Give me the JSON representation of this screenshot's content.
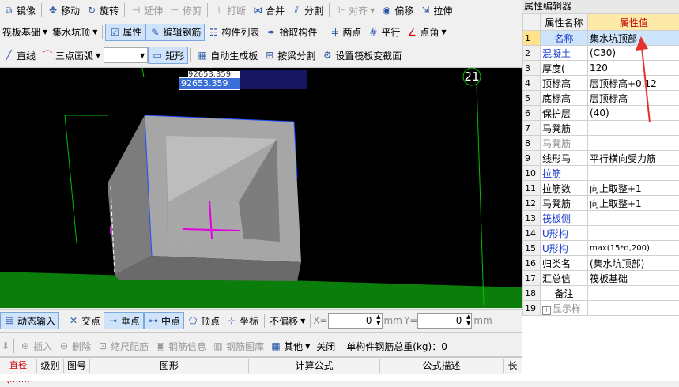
{
  "toolbar1": {
    "mirror": "镜像",
    "move": "移动",
    "rotate": "旋转",
    "extend": "延伸",
    "trim": "修剪",
    "break": "打断",
    "merge": "合并",
    "split": "分割",
    "align": "对齐",
    "offset": "偏移",
    "stretch": "拉伸"
  },
  "toolbar2": {
    "category": "筏板基础",
    "component": "集水坑顶",
    "properties": "属性",
    "edit_rebar": "编辑钢筋",
    "component_list": "构件列表",
    "pick_component": "拾取构件",
    "two_points": "两点",
    "parallel": "平行",
    "point_angle": "点角"
  },
  "toolbar3": {
    "line": "直线",
    "arc": "三点画弧",
    "rect": "矩形",
    "auto_raft": "自动生成板",
    "split_by_beam": "按梁分割",
    "set_variable_section": "设置筏板变截面"
  },
  "canvas": {
    "coord_top": "92653.359",
    "coord_input": "92653.359",
    "axis_label": "21"
  },
  "snapbar": {
    "dynamic_input": "动态输入",
    "intersection": "交点",
    "perpendicular": "垂点",
    "midpoint": "中点",
    "vertex": "顶点",
    "coordinate": "坐标",
    "offset_mode": "不偏移",
    "x_label": "X=",
    "x_value": "0",
    "x_unit": "mm",
    "y_label": "Y=",
    "y_value": "0",
    "y_unit": "mm"
  },
  "rebarbar": {
    "insert": "插入",
    "delete": "删除",
    "scale": "缩尺配筋",
    "rebar_info": "钢筋信息",
    "rebar_library": "钢筋图库",
    "other": "其他",
    "close": "关闭",
    "total_label": "单构件钢筋总重(kg)：0"
  },
  "rebar_table": {
    "headers": [
      "直径(mm)",
      "级别",
      "图号",
      "图形",
      "计算公式",
      "公式描述",
      "长"
    ]
  },
  "props": {
    "title": "属性编辑器",
    "col_name": "属性名称",
    "col_value": "属性值",
    "rows": [
      {
        "n": "1",
        "name": "名称",
        "value": "集水坑顶部"
      },
      {
        "n": "2",
        "name": "混凝土",
        "value": "(C30)"
      },
      {
        "n": "3",
        "name": "厚度(",
        "value": "120"
      },
      {
        "n": "4",
        "name": "顶标高",
        "value": "层顶标高+0.12"
      },
      {
        "n": "5",
        "name": "底标高",
        "value": "层顶标高"
      },
      {
        "n": "6",
        "name": "保护层",
        "value": "(40)"
      },
      {
        "n": "7",
        "name": "马凳筋",
        "value": ""
      },
      {
        "n": "8",
        "name": "马凳筋",
        "value": ""
      },
      {
        "n": "9",
        "name": "线形马",
        "value": "平行横向受力筋"
      },
      {
        "n": "10",
        "name": "拉筋",
        "value": ""
      },
      {
        "n": "11",
        "name": "拉筋数",
        "value": "向上取整+1"
      },
      {
        "n": "12",
        "name": "马凳筋",
        "value": "向上取整+1"
      },
      {
        "n": "13",
        "name": "筏板侧",
        "value": ""
      },
      {
        "n": "14",
        "name": "U形构",
        "value": ""
      },
      {
        "n": "15",
        "name": "U形构",
        "value": "max(15*d,200)"
      },
      {
        "n": "16",
        "name": "归类名",
        "value": "(集水坑顶部)"
      },
      {
        "n": "17",
        "name": "汇总信",
        "value": "筏板基础"
      },
      {
        "n": "18",
        "name": "备注",
        "value": ""
      },
      {
        "n": "19",
        "name": "显示样",
        "value": ""
      }
    ]
  }
}
